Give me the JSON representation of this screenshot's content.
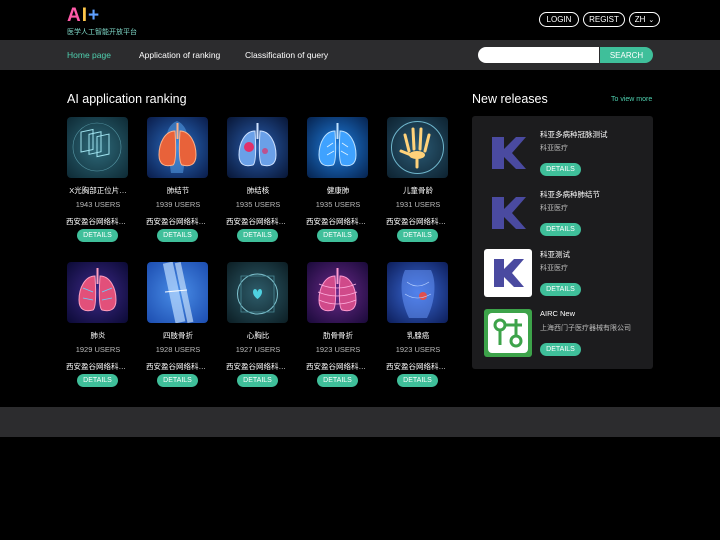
{
  "header": {
    "logo_text": "AI+",
    "logo_subtitle": "医学人工智能开放平台",
    "login_label": "LOGIN",
    "regist_label": "REGIST",
    "language": "ZH"
  },
  "nav": {
    "items": [
      {
        "label": "Home page",
        "active": true
      },
      {
        "label": "Application of ranking",
        "active": false
      },
      {
        "label": "Classification of query",
        "active": false
      }
    ],
    "search_placeholder": "",
    "search_label": "SEARCH"
  },
  "ranking": {
    "title": "AI application ranking",
    "items": [
      {
        "name": "X光胸部正位片…",
        "users": "1943 USERS",
        "org": "西安盈谷网络科…",
        "details": "DETAILS",
        "icon": "chest-xray-icon"
      },
      {
        "name": "肺结节",
        "users": "1939 USERS",
        "org": "西安盈谷网络科…",
        "details": "DETAILS",
        "icon": "lung-nodule-icon"
      },
      {
        "name": "肺结核",
        "users": "1935 USERS",
        "org": "西安盈谷网络科…",
        "details": "DETAILS",
        "icon": "tuberculosis-icon"
      },
      {
        "name": "健康肺",
        "users": "1935 USERS",
        "org": "西安盈谷网络科…",
        "details": "DETAILS",
        "icon": "healthy-lung-icon"
      },
      {
        "name": "儿童骨龄",
        "users": "1931 USERS",
        "org": "西安盈谷网络科…",
        "details": "DETAILS",
        "icon": "hand-bone-icon"
      },
      {
        "name": "肺炎",
        "users": "1929 USERS",
        "org": "西安盈谷网络科…",
        "details": "DETAILS",
        "icon": "pneumonia-icon"
      },
      {
        "name": "四肢骨折",
        "users": "1928 USERS",
        "org": "西安盈谷网络科…",
        "details": "DETAILS",
        "icon": "limb-fracture-icon"
      },
      {
        "name": "心胸比",
        "users": "1927 USERS",
        "org": "西安盈谷网络科…",
        "details": "DETAILS",
        "icon": "cardiothoracic-icon"
      },
      {
        "name": "肋骨骨折",
        "users": "1923 USERS",
        "org": "西安盈谷网络科…",
        "details": "DETAILS",
        "icon": "rib-fracture-icon"
      },
      {
        "name": "乳腺癌",
        "users": "1923 USERS",
        "org": "西安盈谷网络科…",
        "details": "DETAILS",
        "icon": "breast-cancer-icon"
      }
    ]
  },
  "releases": {
    "title": "New releases",
    "view_more": "To view more",
    "items": [
      {
        "name": "科亚多病种冠脉测试",
        "org": "科亚医疗",
        "details": "DETAILS",
        "icon": "keya-logo-icon"
      },
      {
        "name": "科亚多病种肺结节",
        "org": "科亚医疗",
        "details": "DETAILS",
        "icon": "keya-logo-icon"
      },
      {
        "name": "科亚测试",
        "org": "科亚医疗",
        "details": "DETAILS",
        "icon": "keya-logo-icon"
      },
      {
        "name": "AIRC New",
        "org": "上海西门子医疗器械有限公司",
        "details": "DETAILS",
        "icon": "airc-logo-icon"
      }
    ]
  },
  "colors": {
    "accent": "#3fbf9a",
    "background": "#000000",
    "panel": "#1c1c1e",
    "nav": "#2c2c2e"
  }
}
